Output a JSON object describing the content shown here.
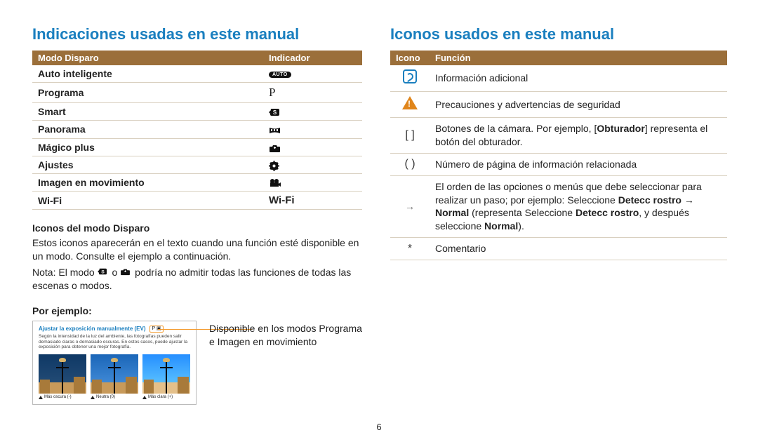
{
  "left": {
    "title": "Indicaciones usadas en este manual",
    "headers": {
      "mode": "Modo Disparo",
      "indicator": "Indicador"
    },
    "rows": [
      {
        "label": "Auto inteligente",
        "iconName": "auto-pill-icon",
        "text": "AUTO"
      },
      {
        "label": "Programa",
        "iconName": "letter-p-icon",
        "text": "P"
      },
      {
        "label": "Smart",
        "iconName": "smart-s-icon",
        "text": ""
      },
      {
        "label": "Panorama",
        "iconName": "panorama-icon",
        "text": ""
      },
      {
        "label": "Mágico plus",
        "iconName": "magic-plus-icon",
        "text": ""
      },
      {
        "label": "Ajustes",
        "iconName": "gear-icon",
        "text": ""
      },
      {
        "label": "Imagen en movimiento",
        "iconName": "movie-icon",
        "text": ""
      },
      {
        "label": "Wi-Fi",
        "iconName": "wifi-text-icon",
        "text": "Wi-Fi"
      }
    ],
    "sub1_head": "Iconos del modo Disparo",
    "sub1_p1": "Estos iconos aparecerán en el texto cuando una función esté disponible en un modo. Consulte el ejemplo a continuación.",
    "sub1_p2a": "Nota: El modo ",
    "sub1_p2b": " o ",
    "sub1_p2c": " podría no admitir todas las funciones de todas las escenas o modos.",
    "example_head": "Por ejemplo:",
    "example_box": {
      "title": "Ajustar la exposición manualmente (EV)",
      "badges": "P ▣",
      "desc": "Según la intensidad de la luz del ambiente, las fotografías pueden salir demasiado claras o demasiado oscuras. En estos casos, puede ajustar la exposición para obtener una mejor fotografía.",
      "caps": [
        "Más oscura (-)",
        "Neutra (0)",
        "Más clara (+)"
      ]
    },
    "example_side": "Disponible en los modos Programa e Imagen en movimiento"
  },
  "right": {
    "title": "Iconos usados en este manual",
    "headers": {
      "icon": "Icono",
      "func": "Función"
    },
    "rows": [
      {
        "iconName": "info-icon",
        "glyph": "",
        "text": "Información adicional"
      },
      {
        "iconName": "warning-icon",
        "glyph": "",
        "text": "Precauciones y advertencias de seguridad"
      },
      {
        "iconName": "brackets-icon",
        "glyph": "[ ]",
        "html": "Botones de la cámara. Por ejemplo, [<b>Obturador</b>] representa el botón del obturador."
      },
      {
        "iconName": "parens-icon",
        "glyph": "( )",
        "text": "Número de página de información relacionada"
      },
      {
        "iconName": "arrow-icon",
        "glyph": "→",
        "html": "El orden de las opciones o menús que debe seleccionar para realizar un paso; por ejemplo: Seleccione <b>Detecc rostro</b> → <b>Normal</b> (representa Seleccione <b>Detecc rostro</b>, y después seleccione <b>Normal</b>)."
      },
      {
        "iconName": "asterisk-icon",
        "glyph": "*",
        "text": "Comentario"
      }
    ]
  },
  "pagenum": "6"
}
